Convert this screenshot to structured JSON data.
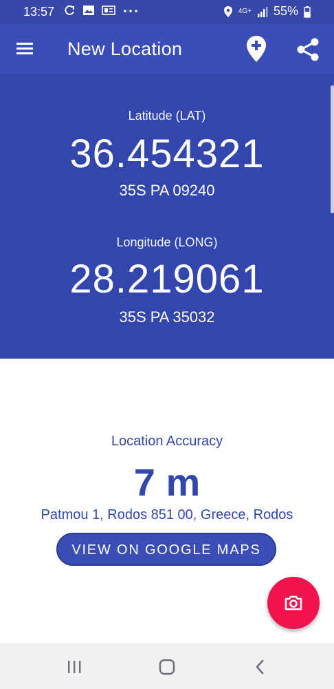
{
  "status_bar": {
    "time": "13:57",
    "battery": "55%",
    "network": "4G+",
    "icons": [
      "sync-icon",
      "image-icon",
      "news-icon",
      "more-dots-icon",
      "location-icon",
      "signal-icon",
      "battery-icon"
    ]
  },
  "app_bar": {
    "title": "New Location",
    "icons": [
      "menu-icon",
      "add-location-icon",
      "share-icon"
    ]
  },
  "latitude": {
    "label": "Latitude (LAT)",
    "value": "36.454321",
    "mgrs": "35S PA 09240"
  },
  "longitude": {
    "label": "Longitude (LONG)",
    "value": "28.219061",
    "mgrs": "35S PA 35032"
  },
  "accuracy": {
    "label": "Location Accuracy",
    "value": "7 m"
  },
  "address": "Patmou 1, Rodos 851 00, Greece, Rodos",
  "maps_button": "VIEW ON GOOGLE MAPS",
  "fab_icon": "camera-icon",
  "nav_bar": {
    "icons": [
      "recent-apps-icon",
      "home-icon",
      "back-icon"
    ]
  },
  "colors": {
    "primary": "#3b4db6",
    "header_bg": "#3346ae",
    "accent": "#f2124e",
    "text_primary": "#3346ae"
  }
}
